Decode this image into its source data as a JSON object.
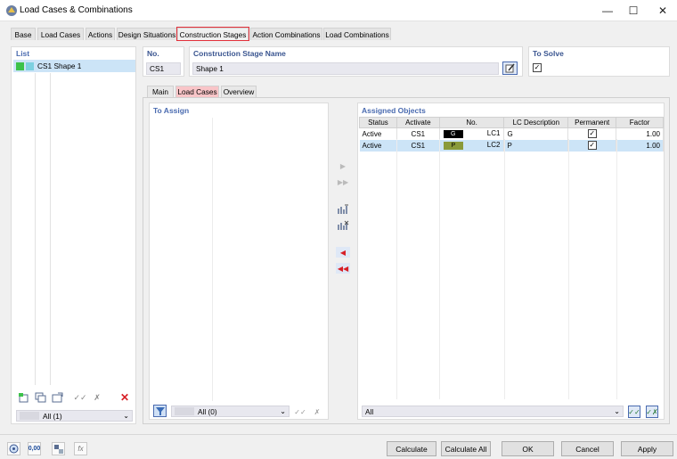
{
  "window": {
    "title": "Load Cases & Combinations"
  },
  "tabs": [
    "Base",
    "Load Cases",
    "Actions",
    "Design Situations",
    "Construction Stages",
    "Action Combinations",
    "Load Combinations"
  ],
  "list": {
    "header": "List",
    "items": [
      {
        "label": "CS1  Shape 1",
        "color1": "#3cc24a",
        "color2": "#7dd0e0"
      }
    ],
    "filter": "All (1)"
  },
  "no": {
    "label": "No.",
    "value": "CS1"
  },
  "name": {
    "label": "Construction Stage Name",
    "value": "Shape 1"
  },
  "to_solve": {
    "label": "To Solve",
    "checked": true
  },
  "subtabs": [
    "Main",
    "Load Cases",
    "Overview"
  ],
  "to_assign": {
    "header": "To Assign",
    "filter": "All (0)"
  },
  "assigned": {
    "header": "Assigned Objects",
    "columns": [
      "Status",
      "Activate",
      "No.",
      "LC Description",
      "Permanent",
      "Factor"
    ],
    "rows": [
      {
        "status": "Active",
        "activate": "CS1",
        "tag": "G",
        "tag_color": "#000000",
        "lc": "LC1",
        "desc": "G",
        "permanent": true,
        "factor": "1.00"
      },
      {
        "status": "Active",
        "activate": "CS1",
        "tag": "P",
        "tag_color": "#8a9a3a",
        "lc": "LC2",
        "desc": "P",
        "permanent": true,
        "factor": "1.00"
      }
    ],
    "filter": "All"
  },
  "footer": {
    "calculate": "Calculate",
    "calculate_all": "Calculate All",
    "ok": "OK",
    "cancel": "Cancel",
    "apply": "Apply",
    "zero_label": "0,00"
  },
  "colors": {
    "accent": "#4a6bb0",
    "highlight": "#cce4f7",
    "active_tab_border": "#e2303a"
  }
}
